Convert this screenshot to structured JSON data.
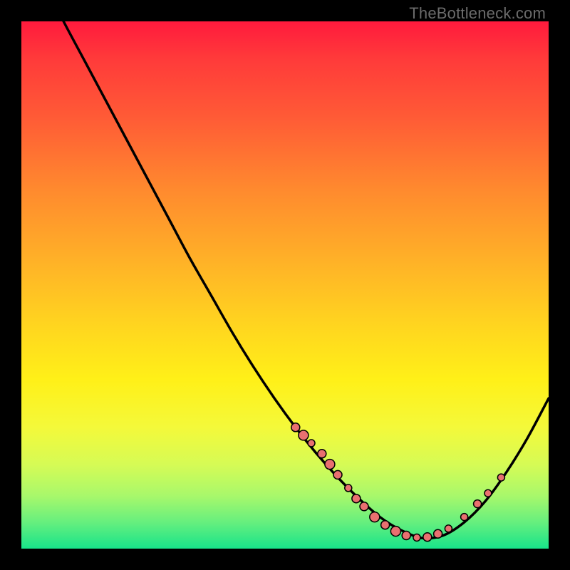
{
  "watermark": "TheBottleneck.com",
  "colors": {
    "background": "#000000",
    "curve_stroke": "#000000",
    "marker_fill": "#e97070",
    "marker_stroke": "#000000"
  },
  "chart_data": {
    "type": "line",
    "title": "",
    "xlabel": "",
    "ylabel": "",
    "xlim": [
      0,
      100
    ],
    "ylim": [
      0,
      100
    ],
    "grid": false,
    "legend": false,
    "x": [
      0,
      4,
      8,
      12,
      16,
      20,
      24,
      28,
      32,
      36,
      40,
      44,
      48,
      52,
      56,
      60,
      64,
      68,
      72,
      76,
      80,
      84,
      88,
      92,
      96,
      100
    ],
    "values": [
      116,
      108,
      100,
      92.5,
      85,
      77.5,
      70,
      62.5,
      55,
      48,
      41,
      34.5,
      28.5,
      23,
      18,
      13.5,
      9.5,
      6,
      3.5,
      2,
      2.5,
      5,
      9,
      14.5,
      21,
      28.5
    ],
    "markers": [
      {
        "x": 52,
        "y": 23,
        "r": 6
      },
      {
        "x": 53.5,
        "y": 21.5,
        "r": 7
      },
      {
        "x": 55,
        "y": 20,
        "r": 5
      },
      {
        "x": 57,
        "y": 18,
        "r": 6
      },
      {
        "x": 58.5,
        "y": 16,
        "r": 7
      },
      {
        "x": 60,
        "y": 14,
        "r": 6
      },
      {
        "x": 62,
        "y": 11.5,
        "r": 5
      },
      {
        "x": 63.5,
        "y": 9.5,
        "r": 6
      },
      {
        "x": 65,
        "y": 8,
        "r": 6
      },
      {
        "x": 67,
        "y": 6,
        "r": 7
      },
      {
        "x": 69,
        "y": 4.5,
        "r": 6
      },
      {
        "x": 71,
        "y": 3.3,
        "r": 7
      },
      {
        "x": 73,
        "y": 2.5,
        "r": 6
      },
      {
        "x": 75,
        "y": 2.1,
        "r": 5
      },
      {
        "x": 77,
        "y": 2.2,
        "r": 6
      },
      {
        "x": 79,
        "y": 2.8,
        "r": 6
      },
      {
        "x": 81,
        "y": 3.8,
        "r": 5
      },
      {
        "x": 84,
        "y": 6,
        "r": 5
      },
      {
        "x": 86.5,
        "y": 8.5,
        "r": 5.5
      },
      {
        "x": 88.5,
        "y": 10.5,
        "r": 5
      },
      {
        "x": 91,
        "y": 13.5,
        "r": 5
      }
    ]
  }
}
